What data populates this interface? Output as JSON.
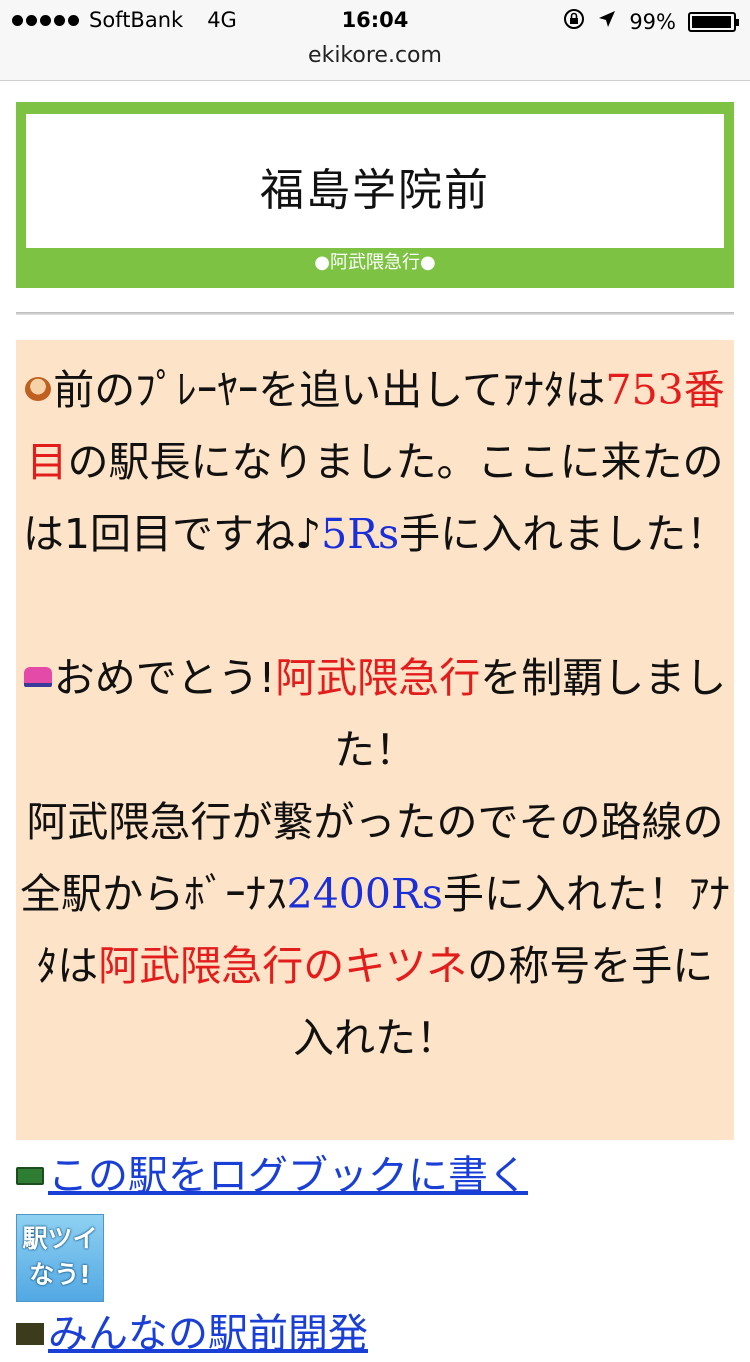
{
  "status_bar": {
    "carrier": "SoftBank",
    "network": "4G",
    "time": "16:04",
    "battery": "99%",
    "icons": [
      "signal-dots-icon",
      "rotation-lock-icon",
      "location-arrow-icon",
      "battery-icon"
    ]
  },
  "browser": {
    "url": "ekikore.com"
  },
  "station": {
    "name": "福島学院前",
    "line_label": "●阿武隈急行●",
    "accent_color": "#7dc242"
  },
  "message": {
    "p1": {
      "a": "前のﾌﾟﾚｰﾔｰを追い出してｱﾅﾀは",
      "rank": "753番目",
      "b": "の駅長になりました。ここに来たのは1回目ですね♪",
      "reward": "5Rs",
      "c": "手に入れました！"
    },
    "p2": {
      "a": "おめでとう!",
      "line": "阿武隈急行",
      "b": "を制覇しました！",
      "c": "阿武隈急行が繋がったのでその路線の全駅からﾎﾞｰﾅｽ",
      "bonus": "2400Rs",
      "d": "手に入れた！ｱﾅﾀは",
      "title": "阿武隈急行のキツネ",
      "e": "の称号を手に入れた！"
    },
    "background_color": "#fde3c7",
    "highlight_red": "#e31c1c",
    "highlight_blue": "#1b2fd8"
  },
  "links": {
    "logbook": "この駅をログブックに書く",
    "tweet_button": "駅ツイなう!",
    "next": "みんなの駅前開発"
  }
}
